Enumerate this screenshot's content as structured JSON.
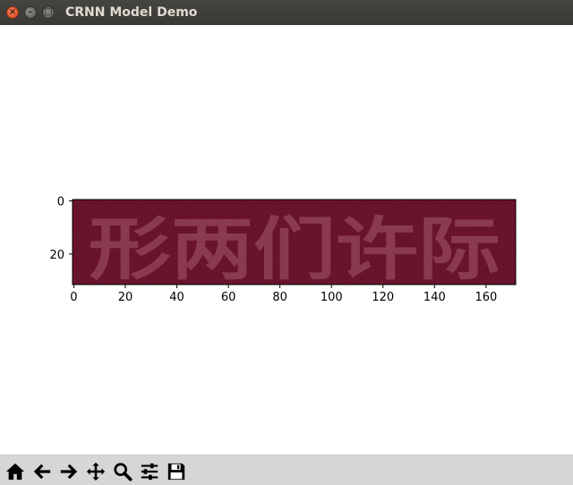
{
  "window": {
    "title": "CRNN Model Demo",
    "close_glyph": "×",
    "minimize_glyph": "–",
    "maximize_glyph": "□"
  },
  "chart_data": {
    "type": "image",
    "image_text": "形两们许际",
    "image_colors": {
      "background": "#5a0a1c",
      "text": "#8a3a4e"
    },
    "x_ticks": [
      "0",
      "20",
      "40",
      "60",
      "80",
      "100",
      "120",
      "140",
      "160"
    ],
    "y_ticks": [
      "0",
      "20"
    ],
    "xlim": [
      -0.5,
      171.5
    ],
    "ylim": [
      31.5,
      -0.5
    ]
  },
  "toolbar": {
    "buttons": [
      {
        "name": "home-icon"
      },
      {
        "name": "back-icon"
      },
      {
        "name": "forward-icon"
      },
      {
        "name": "pan-icon"
      },
      {
        "name": "zoom-icon"
      },
      {
        "name": "subplots-icon"
      },
      {
        "name": "save-icon"
      }
    ]
  }
}
